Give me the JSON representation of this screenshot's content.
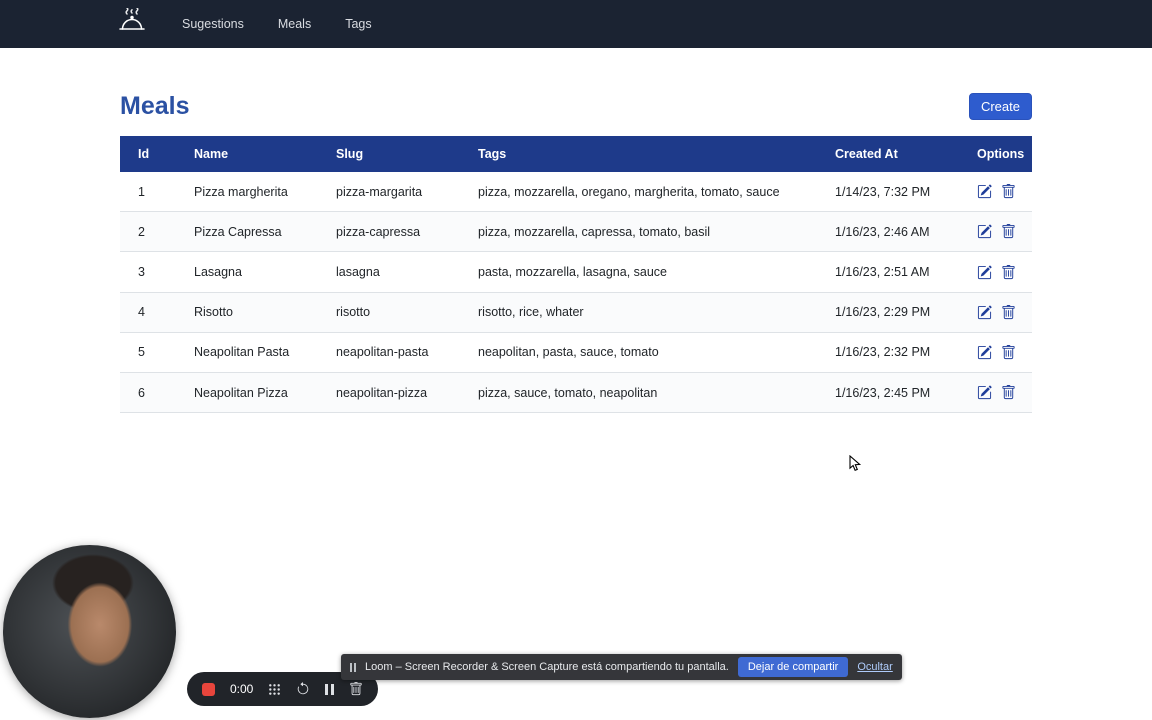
{
  "navbar": {
    "items": [
      {
        "label": "Sugestions"
      },
      {
        "label": "Meals"
      },
      {
        "label": "Tags"
      }
    ]
  },
  "page": {
    "title": "Meals",
    "create_button": "Create"
  },
  "table": {
    "headers": [
      "Id",
      "Name",
      "Slug",
      "Tags",
      "Created At",
      "Options"
    ],
    "rows": [
      {
        "id": "1",
        "name": "Pizza margherita",
        "slug": "pizza-margarita",
        "tags": "pizza, mozzarella, oregano, margherita, tomato, sauce",
        "created_at": "1/14/23, 7:32 PM"
      },
      {
        "id": "2",
        "name": "Pizza Capressa",
        "slug": "pizza-capressa",
        "tags": "pizza, mozzarella, capressa, tomato, basil",
        "created_at": "1/16/23, 2:46 AM"
      },
      {
        "id": "3",
        "name": "Lasagna",
        "slug": "lasagna",
        "tags": "pasta, mozzarella, lasagna, sauce",
        "created_at": "1/16/23, 2:51 AM"
      },
      {
        "id": "4",
        "name": "Risotto",
        "slug": "risotto",
        "tags": "risotto, rice, whater",
        "created_at": "1/16/23, 2:29 PM"
      },
      {
        "id": "5",
        "name": "Neapolitan Pasta",
        "slug": "neapolitan-pasta",
        "tags": "neapolitan, pasta, sauce, tomato",
        "created_at": "1/16/23, 2:32 PM"
      },
      {
        "id": "6",
        "name": "Neapolitan Pizza",
        "slug": "neapolitan-pizza",
        "tags": "pizza, sauce, tomato, neapolitan",
        "created_at": "1/16/23, 2:45 PM"
      }
    ]
  },
  "recorder": {
    "time": "0:00"
  },
  "share_bar": {
    "message": "Loom – Screen Recorder & Screen Capture está compartiendo tu pantalla.",
    "stop_button": "Dejar de compartir",
    "hide_link": "Ocultar"
  },
  "colors": {
    "navbar_bg": "#1b2332",
    "table_header_bg": "#1e3a8a",
    "accent_blue": "#2b51a3",
    "create_button_bg": "#2e5cce",
    "record_red": "#e8453c",
    "share_button_bg": "#3f6ad3"
  }
}
